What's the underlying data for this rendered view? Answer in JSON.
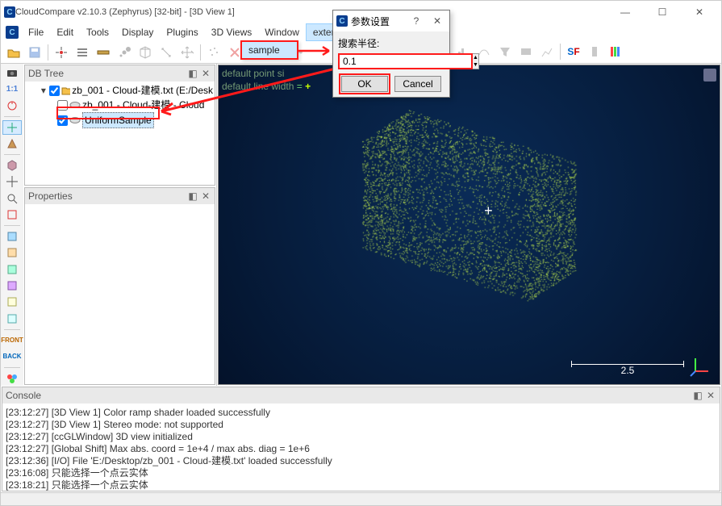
{
  "title": "CloudCompare v2.10.3 (Zephyrus) [32-bit] - [3D View 1]",
  "menus": {
    "file": "File",
    "edit": "Edit",
    "tools": "Tools",
    "display": "Display",
    "plugins": "Plugins",
    "views3d": "3D Views",
    "window": "Window",
    "extend": "extend"
  },
  "dropdown": {
    "sample": "sample"
  },
  "panels": {
    "dbtree": "DB Tree",
    "properties": "Properties",
    "console": "Console"
  },
  "tree": {
    "root": {
      "label": "zb_001 - Cloud-建模.txt (E:/Desk"
    },
    "cloud": {
      "label": "zb_001 - Cloud-建模 - Cloud"
    },
    "sample": {
      "label": "UniformSample"
    }
  },
  "overlay": {
    "line1_a": "default point si",
    "line1_plus": "+",
    "line2_a": "default line width",
    "line2_eq": " = ",
    "line2_plus": "+"
  },
  "scale": {
    "value": "2.5"
  },
  "dialog": {
    "title": "参数设置",
    "field_label": "搜索半径:",
    "value": "0.1",
    "ok": "OK",
    "cancel": "Cancel"
  },
  "console_lines": [
    "[23:12:27] [3D View 1] Color ramp shader loaded successfully",
    "[23:12:27] [3D View 1] Stereo mode: not supported",
    "[23:12:27] [ccGLWindow] 3D view initialized",
    "[23:12:27] [Global Shift] Max abs. coord = 1e+4 / max abs. diag = 1e+6",
    "[23:12:36] [I/O] File 'E:/Desktop/zb_001 - Cloud-建模.txt' loaded successfully",
    "[23:16:08] 只能选择一个点云实体",
    "[23:18:21] 只能选择一个点云实体"
  ]
}
